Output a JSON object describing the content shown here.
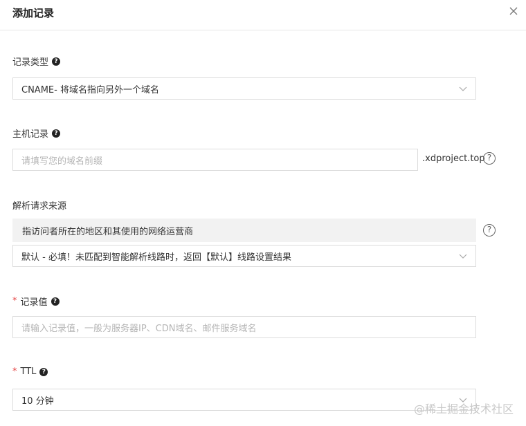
{
  "dialog": {
    "title": "添加记录",
    "close_icon": "close-icon"
  },
  "record_type": {
    "label": "记录类型",
    "help": "?",
    "value": "CNAME- 将域名指向另外一个域名"
  },
  "host_record": {
    "label": "主机记录",
    "help": "?",
    "placeholder": "请填写您的域名前缀",
    "suffix": ".xdproject.top",
    "help_circle": "?"
  },
  "resolution_source": {
    "label": "解析请求来源",
    "info": "指访问者所在的地区和其使用的网络运营商",
    "help_circle": "?",
    "value": "默认 - 必填！未匹配到智能解析线路时，返回【默认】线路设置结果"
  },
  "record_value": {
    "required": "*",
    "label": "记录值",
    "help": "?",
    "placeholder": "请输入记录值，一般为服务器IP、CDN域名、邮件服务域名"
  },
  "ttl": {
    "required": "*",
    "label": "TTL",
    "help": "?",
    "value": "10 分钟"
  },
  "watermark": "@稀土掘金技术社区",
  "colors": {
    "required": "#e54545",
    "border": "#dcdcdc",
    "info_bg": "#f2f2f2"
  }
}
